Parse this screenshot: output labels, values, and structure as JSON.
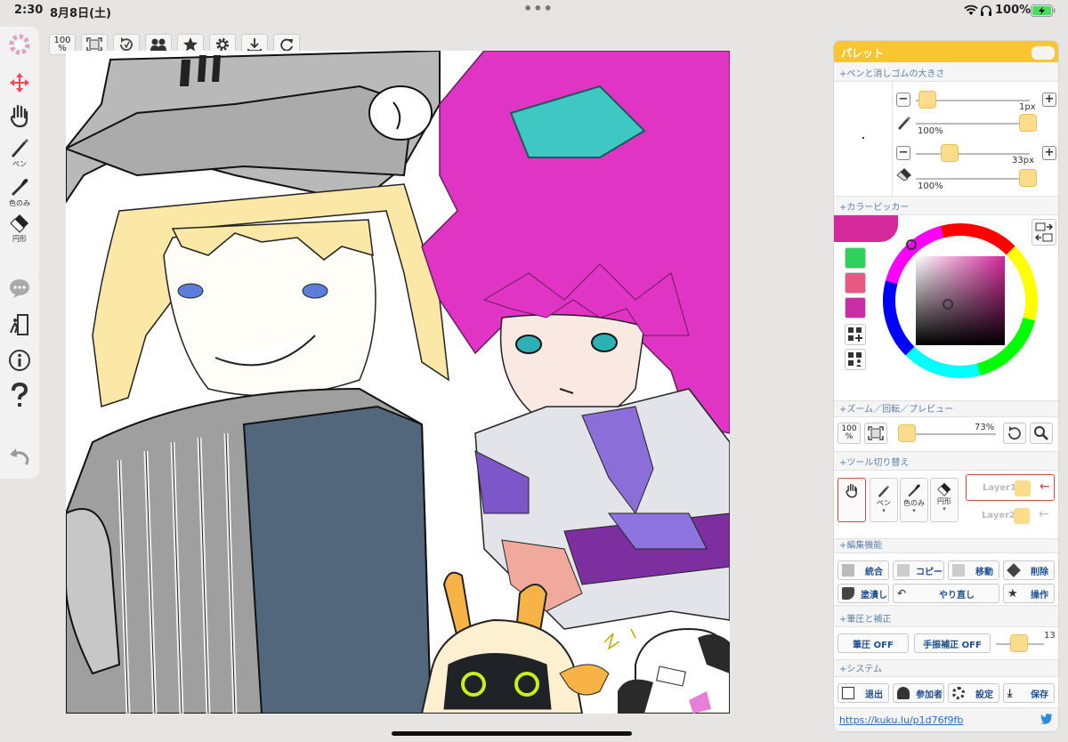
{
  "status_bar": {
    "time": "2:30",
    "date": "8月8日(土)",
    "battery_percent": "100%",
    "dots": "•••"
  },
  "left_tools": {
    "pen_label": "ペン",
    "eyedropper_label": "色のみ",
    "shape_label": "円形"
  },
  "toolbar": {
    "zoom_label_top": "100",
    "zoom_label_bottom": "%"
  },
  "palette": {
    "title": "パレット",
    "sections": {
      "pen_eraser_size": "+ペンと消しゴムの大きさ",
      "color_picker": "+カラーピッカー",
      "zoom_rotate": "+ズーム／回転／プレビュー",
      "tool_switch": "+ツール切り替え",
      "edit": "+編集機能",
      "pressure": "+筆圧と補正",
      "system": "+システム"
    },
    "pen": {
      "size": "1px",
      "opacity": "100%"
    },
    "eraser": {
      "size": "33px",
      "opacity": "100%"
    },
    "zoom": {
      "button_top": "100",
      "button_bottom": "%",
      "value": "73%"
    },
    "tools": {
      "pen": "ペン",
      "eyedropper": "色のみ",
      "shape": "円形",
      "arrow": "▾"
    },
    "layers": [
      {
        "name": "Layer1"
      },
      {
        "name": "Layer2"
      }
    ],
    "edit_buttons": {
      "merge": "統合",
      "copy": "コピー",
      "move": "移動",
      "delete": "削除",
      "fill": "塗潰し",
      "redo": "やり直し",
      "operation": "操作"
    },
    "pressure_buttons": {
      "pressure": "筆圧 OFF",
      "stabilizer": "手振補正 OFF",
      "value": "13"
    },
    "system_buttons": {
      "exit": "退出",
      "participants": "参加者",
      "settings": "設定",
      "save": "保存"
    },
    "url": "https://kuku.lu/p1d76f9fb"
  },
  "colors": {
    "current": "#d5289b",
    "swatches": [
      "#2ed15a",
      "#e85880",
      "#c92ea6"
    ],
    "panel_header": "#f9c632"
  }
}
